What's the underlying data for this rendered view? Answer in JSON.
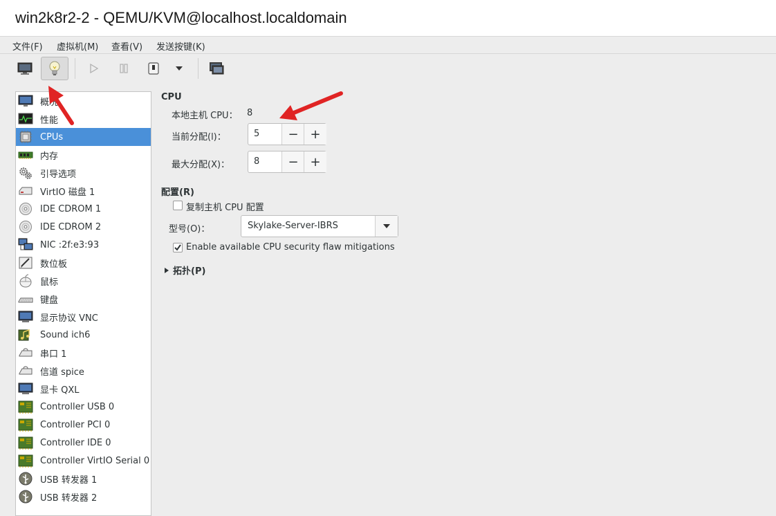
{
  "window": {
    "title": "win2k8r2-2 - QEMU/KVM@localhost.localdomain"
  },
  "menubar": {
    "items": [
      "文件(F)",
      "虚拟机(M)",
      "查看(V)",
      "发送按键(K)"
    ]
  },
  "toolbar": {
    "buttons": [
      "console-icon",
      "lightbulb-icon",
      "play-icon",
      "pause-icon",
      "power-icon",
      "chevron-down-icon",
      "screenshot-icon"
    ],
    "active": "lightbulb-icon"
  },
  "sidebar": {
    "items": [
      {
        "label": "概况",
        "icon": "monitor-icon"
      },
      {
        "label": "性能",
        "icon": "performance-icon"
      },
      {
        "label": "CPUs",
        "icon": "cpu-icon",
        "selected": true
      },
      {
        "label": "内存",
        "icon": "memory-icon"
      },
      {
        "label": "引导选项",
        "icon": "gears-icon"
      },
      {
        "label": "VirtIO 磁盘 1",
        "icon": "disk-icon"
      },
      {
        "label": "IDE CDROM 1",
        "icon": "cdrom-icon"
      },
      {
        "label": "IDE CDROM 2",
        "icon": "cdrom-icon"
      },
      {
        "label": "NIC :2f:e3:93",
        "icon": "network-icon"
      },
      {
        "label": "数位板",
        "icon": "tablet-icon"
      },
      {
        "label": "鼠标",
        "icon": "mouse-icon"
      },
      {
        "label": "键盘",
        "icon": "keyboard-icon"
      },
      {
        "label": "显示协议 VNC",
        "icon": "display-icon"
      },
      {
        "label": "Sound ich6",
        "icon": "sound-icon"
      },
      {
        "label": "串口 1",
        "icon": "serial-icon"
      },
      {
        "label": "信道 spice",
        "icon": "channel-icon"
      },
      {
        "label": "显卡 QXL",
        "icon": "video-icon"
      },
      {
        "label": "Controller USB 0",
        "icon": "controller-icon"
      },
      {
        "label": "Controller PCI 0",
        "icon": "controller-icon"
      },
      {
        "label": "Controller IDE 0",
        "icon": "controller-icon"
      },
      {
        "label": "Controller VirtIO Serial 0",
        "icon": "controller-icon"
      },
      {
        "label": "USB 转发器 1",
        "icon": "usb-icon"
      },
      {
        "label": "USB 转发器 2",
        "icon": "usb-icon"
      }
    ]
  },
  "cpu": {
    "section_title": "CPU",
    "host_cpu_label": "本地主机 CPU：",
    "host_cpu_value": "8",
    "current_label": "当前分配(l)：",
    "current_value": "5",
    "max_label": "最大分配(X)：",
    "max_value": "8",
    "minus": "−",
    "plus": "+"
  },
  "config": {
    "section_title": "配置(R)",
    "copy_host_label": "复制主机 CPU 配置",
    "copy_host_checked": false,
    "model_label": "型号(O)：",
    "model_value": "Skylake-Server-IBRS",
    "mitigation_label": "Enable available CPU security flaw mitigations",
    "mitigation_checked": true
  },
  "topology": {
    "expander_label": "拓扑(P)",
    "expanded": false
  },
  "colors": {
    "selection": "#4a90d9",
    "arrow": "#e02424"
  }
}
